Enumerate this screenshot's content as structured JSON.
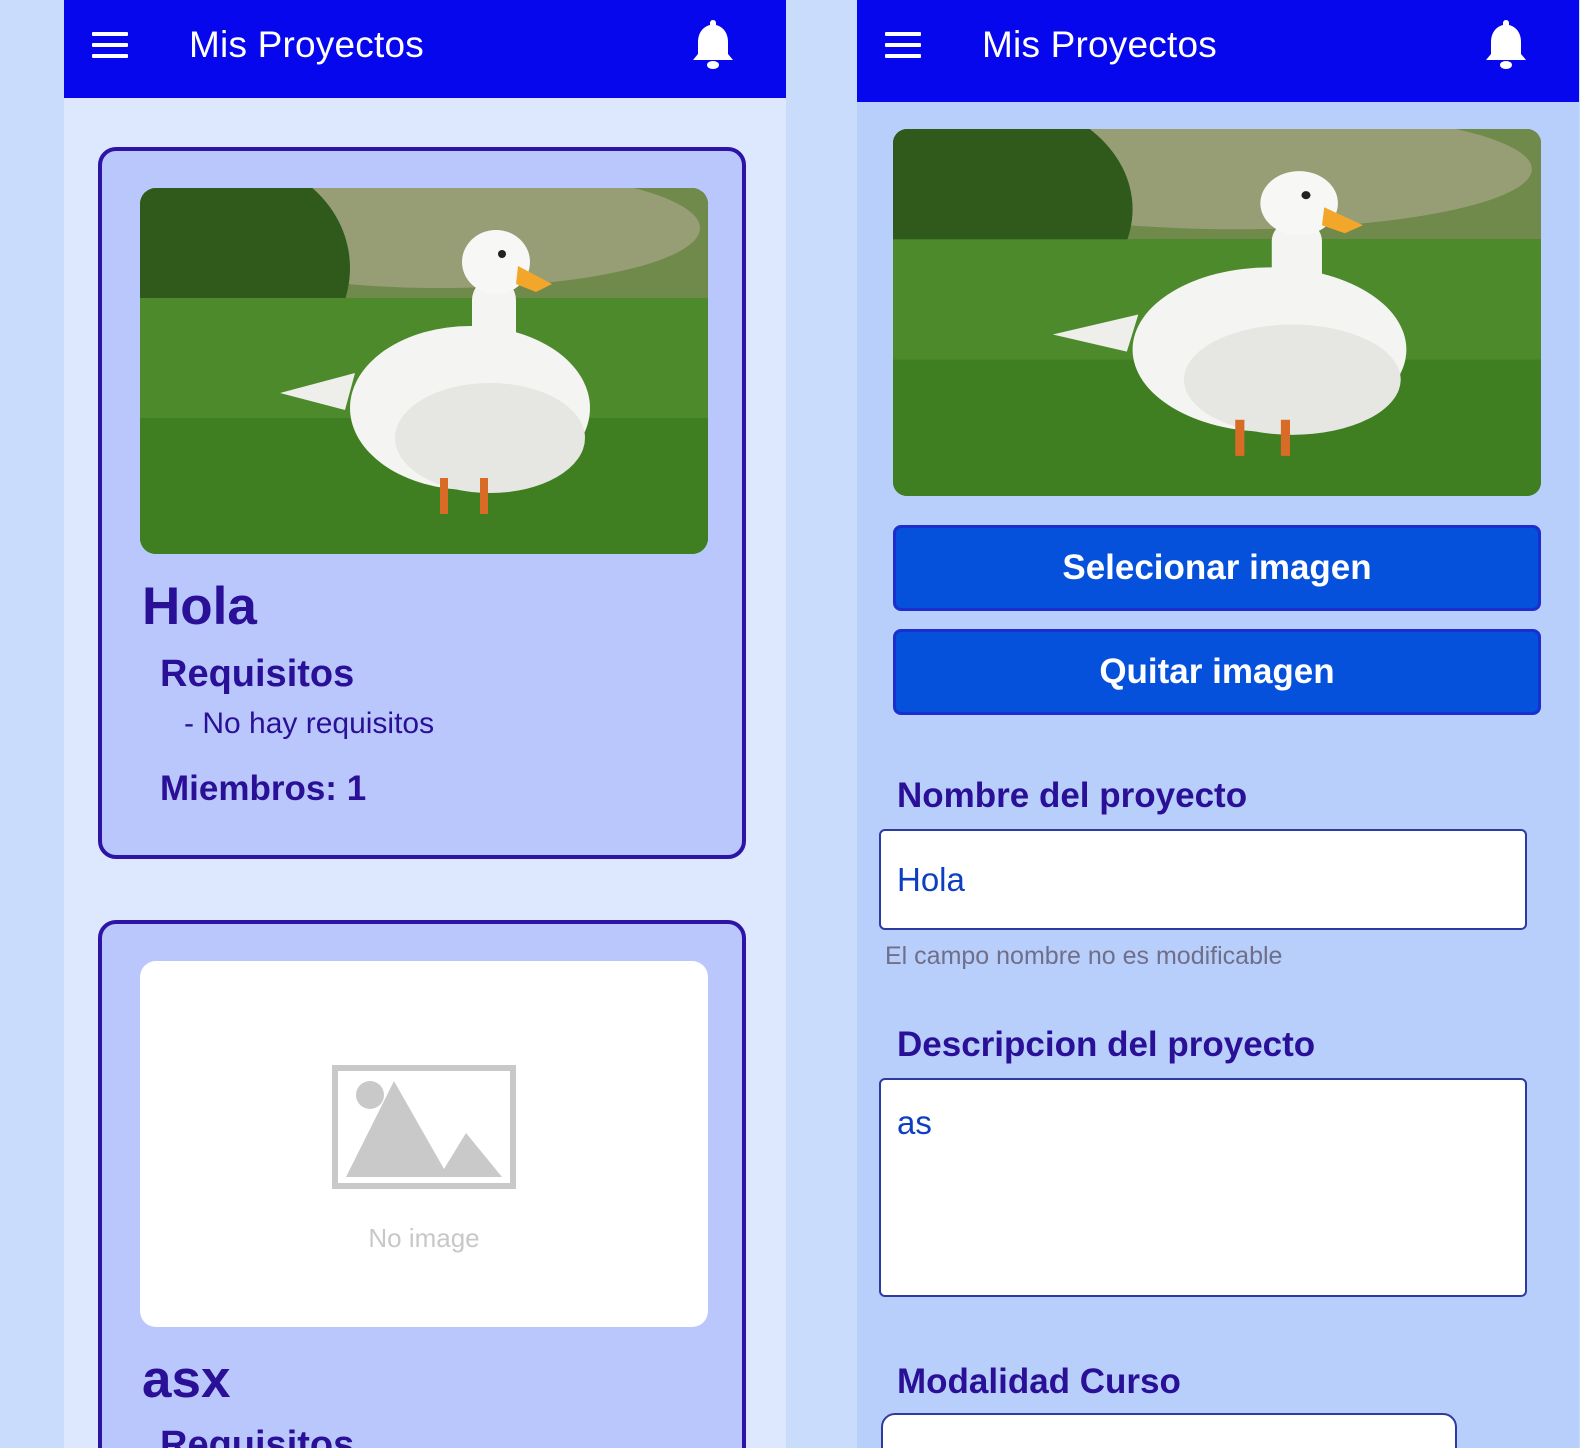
{
  "left_screen": {
    "appbar": {
      "title": "Mis Proyectos",
      "menu_icon": "menu-icon",
      "bell_icon": "bell-icon"
    },
    "projects": [
      {
        "title": "Hola",
        "requirements_heading": "Requisitos",
        "requirements": [
          "- No hay requisitos"
        ],
        "members_label": "Miembros: 1",
        "image": "duck-photo"
      },
      {
        "title": "asx",
        "requirements_heading": "Requisitos",
        "image": "no-image-placeholder",
        "no_image_label": "No image"
      }
    ]
  },
  "right_screen": {
    "appbar": {
      "title": "Mis Proyectos",
      "menu_icon": "menu-icon",
      "bell_icon": "bell-icon"
    },
    "image": "duck-photo",
    "select_button_label": "Selecionar imagen",
    "remove_button_label": "Quitar imagen",
    "name_label": "Nombre del proyecto",
    "name_value": "Hola",
    "name_helper": "El campo nombre no es modificable",
    "description_label": "Descripcion del proyecto",
    "description_value": "as",
    "modality_label": "Modalidad Curso"
  },
  "colors": {
    "appbar": "#0707ee",
    "card_bg": "#bac7fc",
    "card_border": "#2d13a6",
    "primary_button": "#0651dc",
    "heading_text": "#2a0f97"
  }
}
